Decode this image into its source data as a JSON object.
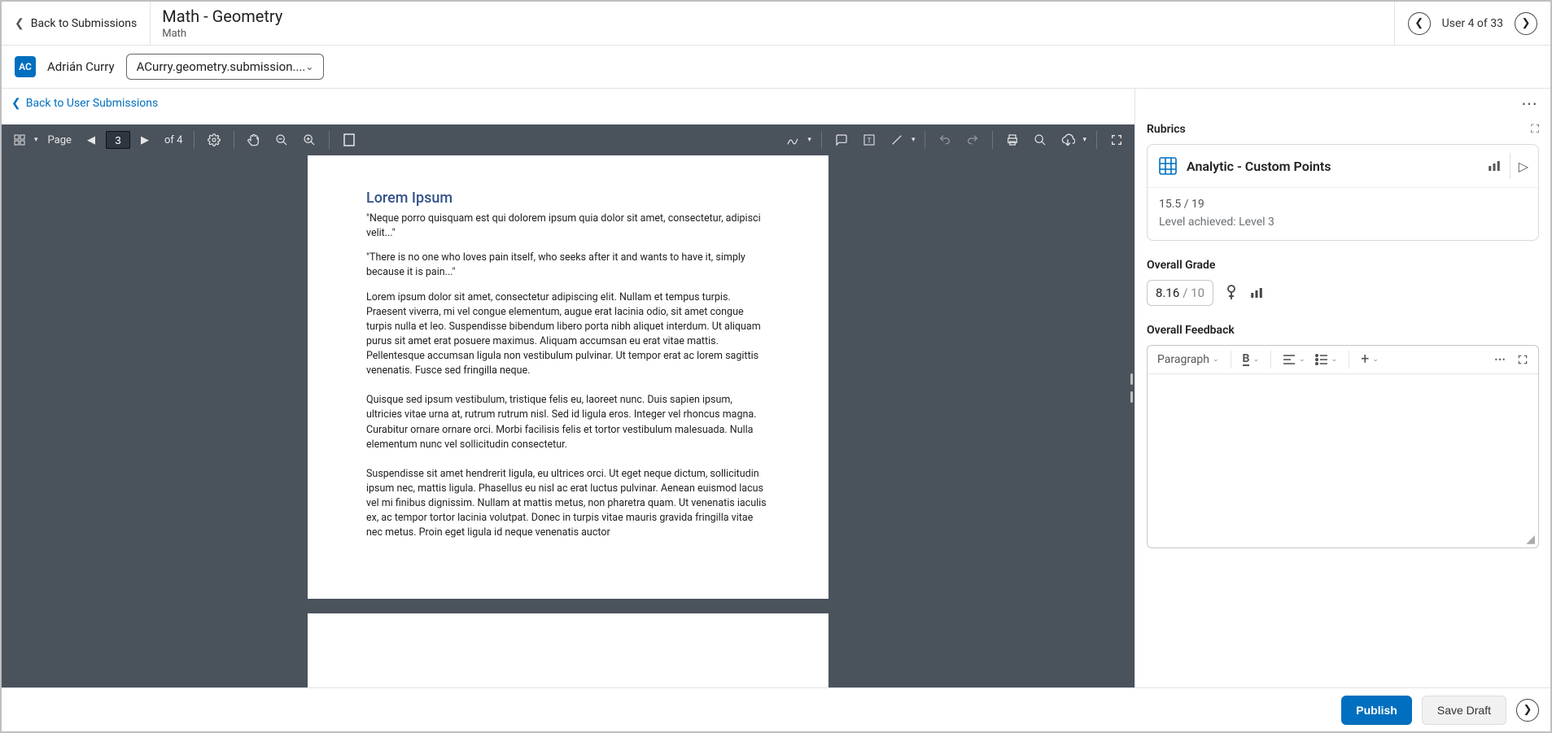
{
  "header": {
    "back_label": "Back to Submissions",
    "title": "Math - Geometry",
    "subtitle": "Math",
    "user_counter": "User 4 of 33"
  },
  "student": {
    "initials": "AC",
    "name": "Adrián Curry",
    "file_label": "ACurry.geometry.submission...."
  },
  "viewer": {
    "back_user_label": "Back to User Submissions",
    "toolbar": {
      "page_label": "Page",
      "page_current": "3",
      "page_total": "of 4"
    },
    "document": {
      "heading": "Lorem Ipsum",
      "quote1": "\"Neque porro quisquam est qui dolorem ipsum quia dolor sit amet, consectetur, adipisci velit...\"",
      "quote2": "\"There is no one who loves pain itself, who seeks after it and wants to have it, simply because it is pain...\"",
      "para1": "Lorem ipsum dolor sit amet, consectetur adipiscing elit. Nullam et tempus turpis. Praesent viverra, mi vel congue elementum, augue erat lacinia odio, sit amet congue turpis nulla et leo. Suspendisse bibendum libero porta nibh aliquet interdum. Ut aliquam purus sit amet erat posuere maximus. Aliquam accumsan eu erat vitae mattis. Pellentesque accumsan ligula non vestibulum pulvinar. Ut tempor erat ac lorem sagittis venenatis. Fusce sed fringilla neque.",
      "para2": "Quisque sed ipsum vestibulum, tristique felis eu, laoreet nunc. Duis sapien ipsum, ultricies vitae urna at, rutrum rutrum nisl. Sed id ligula eros. Integer vel rhoncus magna. Curabitur ornare ornare orci. Morbi facilisis felis et tortor vestibulum malesuada. Nulla elementum nunc vel sollicitudin consectetur.",
      "para3": "Suspendisse sit amet hendrerit ligula, eu ultrices orci. Ut eget neque dictum, sollicitudin ipsum nec, mattis ligula. Phasellus eu nisl ac erat luctus pulvinar. Aenean euismod lacus vel mi finibus dignissim. Nullam at mattis metus, non pharetra quam. Ut venenatis iaculis ex, ac tempor tortor lacinia volutpat. Donec in turpis vitae mauris gravida fringilla vitae nec metus. Proin eget ligula id neque venenatis auctor"
    }
  },
  "rubrics": {
    "section_label": "Rubrics",
    "title": "Analytic - Custom Points",
    "score": "15.5 / 19",
    "level": "Level achieved: Level 3"
  },
  "grade": {
    "section_label": "Overall Grade",
    "value": "8.16",
    "denominator": "/ 10"
  },
  "feedback": {
    "section_label": "Overall Feedback",
    "format_label": "Paragraph"
  },
  "footer": {
    "publish": "Publish",
    "save_draft": "Save Draft"
  }
}
